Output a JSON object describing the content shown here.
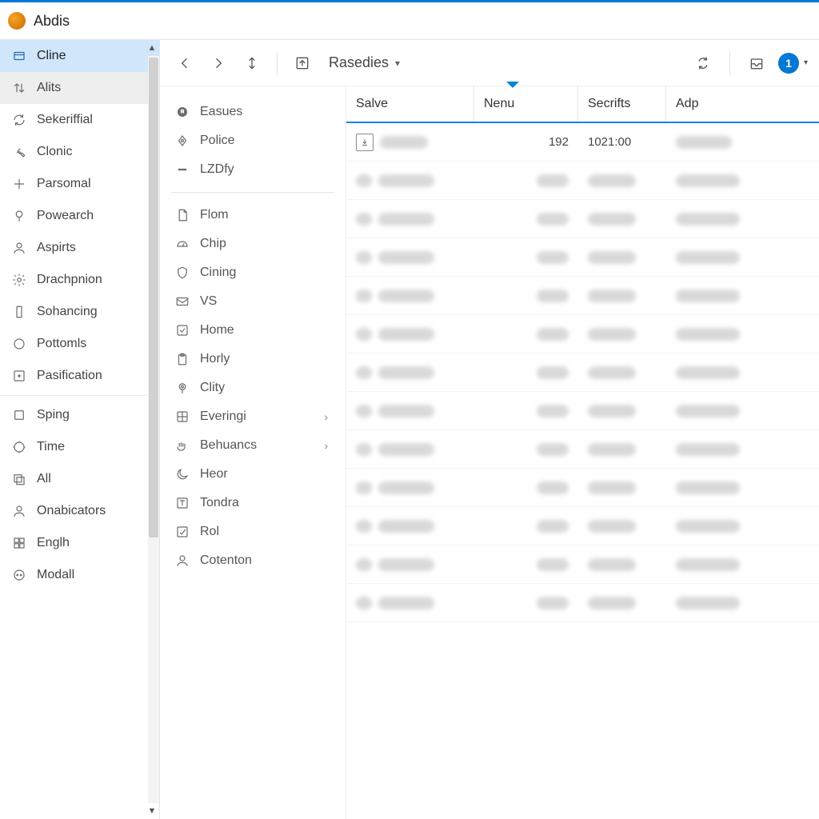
{
  "header": {
    "title": "Abdis"
  },
  "sidebar": {
    "groups": [
      [
        {
          "label": "Cline",
          "icon": "box",
          "selected": true
        },
        {
          "label": "Alits",
          "icon": "updown",
          "hover": true
        },
        {
          "label": "Sekeriffial",
          "icon": "refresh"
        },
        {
          "label": "Clonic",
          "icon": "wrench"
        },
        {
          "label": "Parsomal",
          "icon": "plus"
        },
        {
          "label": "Powearch",
          "icon": "pin"
        },
        {
          "label": "Aspirts",
          "icon": "person"
        },
        {
          "label": "Drachpnion",
          "icon": "gear"
        },
        {
          "label": "Sohancing",
          "icon": "phone"
        },
        {
          "label": "Pottomls",
          "icon": "circle"
        },
        {
          "label": "Pasification",
          "icon": "collapse"
        }
      ],
      [
        {
          "label": "Sping",
          "icon": "square"
        },
        {
          "label": "Time",
          "icon": "target"
        },
        {
          "label": "All",
          "icon": "stack"
        },
        {
          "label": "Onabicators",
          "icon": "person"
        },
        {
          "label": "Englh",
          "icon": "grid"
        },
        {
          "label": "Modall",
          "icon": "dots"
        }
      ]
    ]
  },
  "toolbar": {
    "breadcrumb": "Rasedies",
    "badge": "1"
  },
  "subpanel": {
    "groups": [
      [
        {
          "label": "Easues",
          "icon": "hand"
        },
        {
          "label": "Police",
          "icon": "diamond"
        },
        {
          "label": "LZDfy",
          "icon": "dash"
        }
      ],
      [
        {
          "label": "Flom",
          "icon": "doc"
        },
        {
          "label": "Chip",
          "icon": "gauge"
        },
        {
          "label": "Cining",
          "icon": "shield"
        },
        {
          "label": "VS",
          "icon": "mail"
        },
        {
          "label": "Home",
          "icon": "check"
        },
        {
          "label": "Horly",
          "icon": "clipboard"
        },
        {
          "label": "Clity",
          "icon": "pinround"
        },
        {
          "label": "Everingi",
          "icon": "grid4",
          "expandable": true
        },
        {
          "label": "Behuancs",
          "icon": "hands",
          "expandable": true
        },
        {
          "label": "Heor",
          "icon": "moon"
        },
        {
          "label": "Tondra",
          "icon": "type"
        },
        {
          "label": "Rol",
          "icon": "checkbox"
        },
        {
          "label": "Cotenton",
          "icon": "person"
        }
      ]
    ]
  },
  "table": {
    "columns": [
      "Salve",
      "Nenu",
      "Secrifts",
      "Adp"
    ],
    "rows": [
      {
        "name": "",
        "nenu": "192",
        "secrifts": "1021:00",
        "adp": "",
        "icon": "arrowfile",
        "blurred": false
      },
      {
        "blurred": true
      },
      {
        "blurred": true
      },
      {
        "blurred": true
      },
      {
        "blurred": true
      },
      {
        "blurred": true
      },
      {
        "blurred": true
      },
      {
        "blurred": true
      },
      {
        "blurred": true
      },
      {
        "blurred": true
      },
      {
        "blurred": true
      },
      {
        "blurred": true
      },
      {
        "blurred": true
      }
    ]
  }
}
